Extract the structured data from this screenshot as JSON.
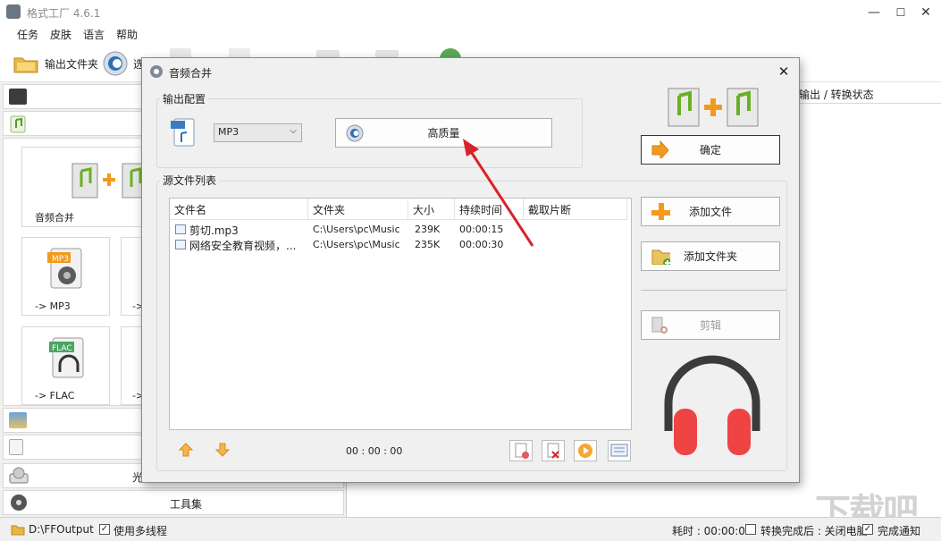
{
  "window": {
    "title": "格式工厂 4.6.1",
    "minimize": "—",
    "maximize": "☐",
    "close": "✕"
  },
  "menu": [
    "任务",
    "皮肤",
    "语言",
    "帮助"
  ],
  "toolbar": {
    "output_folder": "输出文件夹",
    "options_partial": "选"
  },
  "left_panel": {
    "tiles": [
      {
        "label": "音频合并"
      },
      {
        "label": "-> MP3",
        "badge": "MP3"
      },
      {
        "label": "-> FLAC",
        "badge": "FLAC"
      },
      {
        "label": "->"
      },
      {
        "label": "->"
      }
    ],
    "optical_partial": "光",
    "tools": "工具集"
  },
  "right_header": "输出 / 转换状态",
  "dialog": {
    "title": "音频合并",
    "close": "✕",
    "output_config": {
      "label": "输出配置",
      "format_value": "MP3",
      "quality_button": "高质量"
    },
    "ok_button": "确定",
    "source_list": {
      "label": "源文件列表",
      "columns": [
        "文件名",
        "文件夹",
        "大小",
        "持续时间",
        "截取片断"
      ],
      "rows": [
        {
          "name": "剪切.mp3",
          "folder": "C:\\Users\\pc\\Music",
          "size": "239K",
          "duration": "00:00:15",
          "clip": ""
        },
        {
          "name": "网络安全教育视频，...",
          "folder": "C:\\Users\\pc\\Music",
          "size": "235K",
          "duration": "00:00:30",
          "clip": ""
        }
      ],
      "total_time": "00 : 00 : 00"
    },
    "add_file_button": "添加文件",
    "add_folder_button": "添加文件夹",
    "edit_button": "剪辑"
  },
  "statusbar": {
    "output_path": "D:\\FFOutput",
    "multithread": "使用多线程",
    "elapsed": "耗时 : 00:00:00",
    "after_convert": "转换完成后 : 关闭电脑",
    "notify": "完成通知"
  },
  "watermark": "下载吧",
  "colors": {
    "arrow": "#d9232a",
    "headphone_cups": "#ef4444",
    "headphone_band": "#3b3b3b",
    "plus": "#f39a1e",
    "note_green": "#6ab023"
  }
}
